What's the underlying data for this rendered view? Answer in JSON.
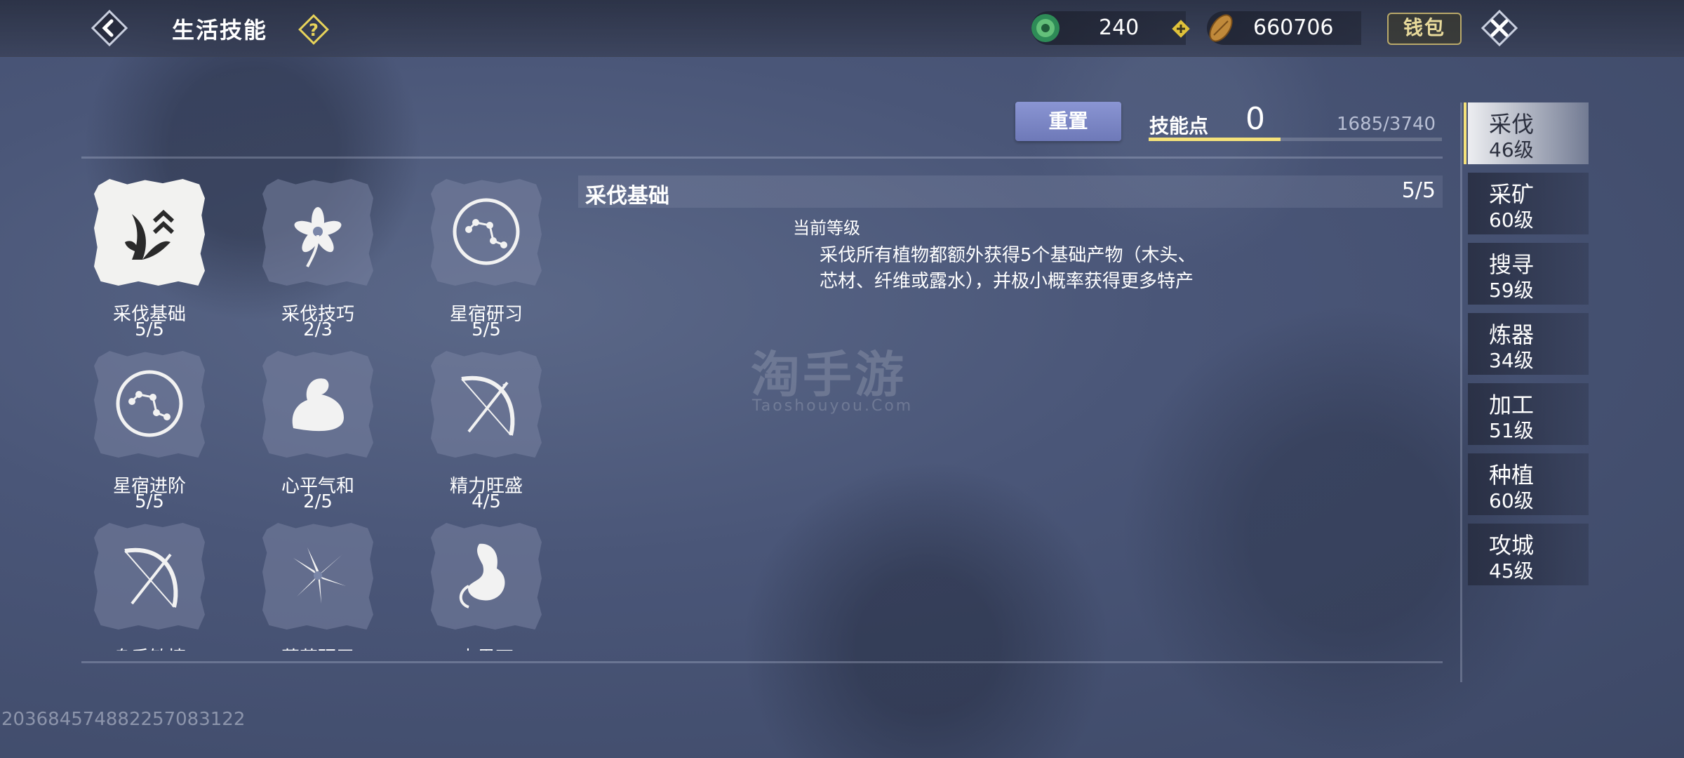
{
  "header": {
    "title": "生活技能",
    "currency_jade": "240",
    "currency_coins": "660706",
    "wallet_label": "钱包"
  },
  "skill_points": {
    "reset_label": "重置",
    "label": "技能点",
    "value": "0",
    "exp_text": "1685/3740",
    "exp_fraction": 0.45
  },
  "skills": [
    {
      "name": "采伐基础",
      "level": "5/5",
      "icon": "leaves-up-icon"
    },
    {
      "name": "采伐技巧",
      "level": "2/3",
      "icon": "flower-icon"
    },
    {
      "name": "星宿研习",
      "level": "5/5",
      "icon": "constellation-icon"
    },
    {
      "name": "星宿进阶",
      "level": "5/5",
      "icon": "constellation-icon"
    },
    {
      "name": "心平气和",
      "level": "2/5",
      "icon": "arm-icon"
    },
    {
      "name": "精力旺盛",
      "level": "4/5",
      "icon": "bow-icon"
    },
    {
      "name": "身手敏捷",
      "level": "",
      "icon": "bow-icon"
    },
    {
      "name": "草药研习",
      "level": "",
      "icon": "herb-icon"
    },
    {
      "name": "木果石",
      "level": "",
      "icon": "stomach-icon"
    }
  ],
  "detail": {
    "title": "采伐基础",
    "level": "5/5",
    "current_level_label": "当前等级",
    "description": "采伐所有植物都额外获得5个基础产物（木头、芯材、纤维或露水），并极小概率获得更多特产"
  },
  "watermark": {
    "main": "淘手游",
    "sub": "Taoshouyou.Com"
  },
  "tabs": [
    {
      "name": "采伐",
      "level": "46级",
      "active": true
    },
    {
      "name": "采矿",
      "level": "60级",
      "active": false
    },
    {
      "name": "搜寻",
      "level": "59级",
      "active": false
    },
    {
      "name": "炼器",
      "level": "34级",
      "active": false
    },
    {
      "name": "加工",
      "level": "51级",
      "active": false
    },
    {
      "name": "种植",
      "level": "60级",
      "active": false
    },
    {
      "name": "攻城",
      "level": "45级",
      "active": false
    }
  ],
  "uid": "203684574882257083122"
}
